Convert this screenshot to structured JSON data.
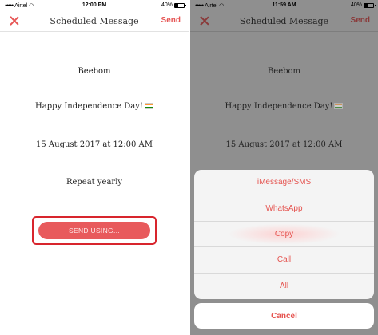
{
  "status_left": {
    "carrier": "Airtel",
    "time": "12:00 PM",
    "battery": "40%"
  },
  "status_right": {
    "carrier": "Airtel",
    "time": "11:59 AM",
    "battery": "40%"
  },
  "nav": {
    "title": "Scheduled Message",
    "send_label": "Send"
  },
  "message": {
    "recipient": "Beebom",
    "text": "Happy Independence Day!",
    "datetime": "15 August 2017 at 12:00 AM",
    "repeat": "Repeat yearly"
  },
  "send_using_label": "SEND USING...",
  "action_sheet": {
    "items": [
      "iMessage/SMS",
      "WhatsApp",
      "Copy",
      "Call",
      "All"
    ],
    "highlighted": "Copy",
    "cancel_label": "Cancel"
  },
  "colors": {
    "accent": "#e65655",
    "button": "#e85a5c",
    "highlight_border": "#d8252d",
    "overlay": "#8f8f8f"
  },
  "icons": {
    "close": "close-icon",
    "flag": "indian-flag-emoji",
    "wifi": "wifi-icon",
    "signal": "signal-icon",
    "battery": "battery-icon"
  }
}
